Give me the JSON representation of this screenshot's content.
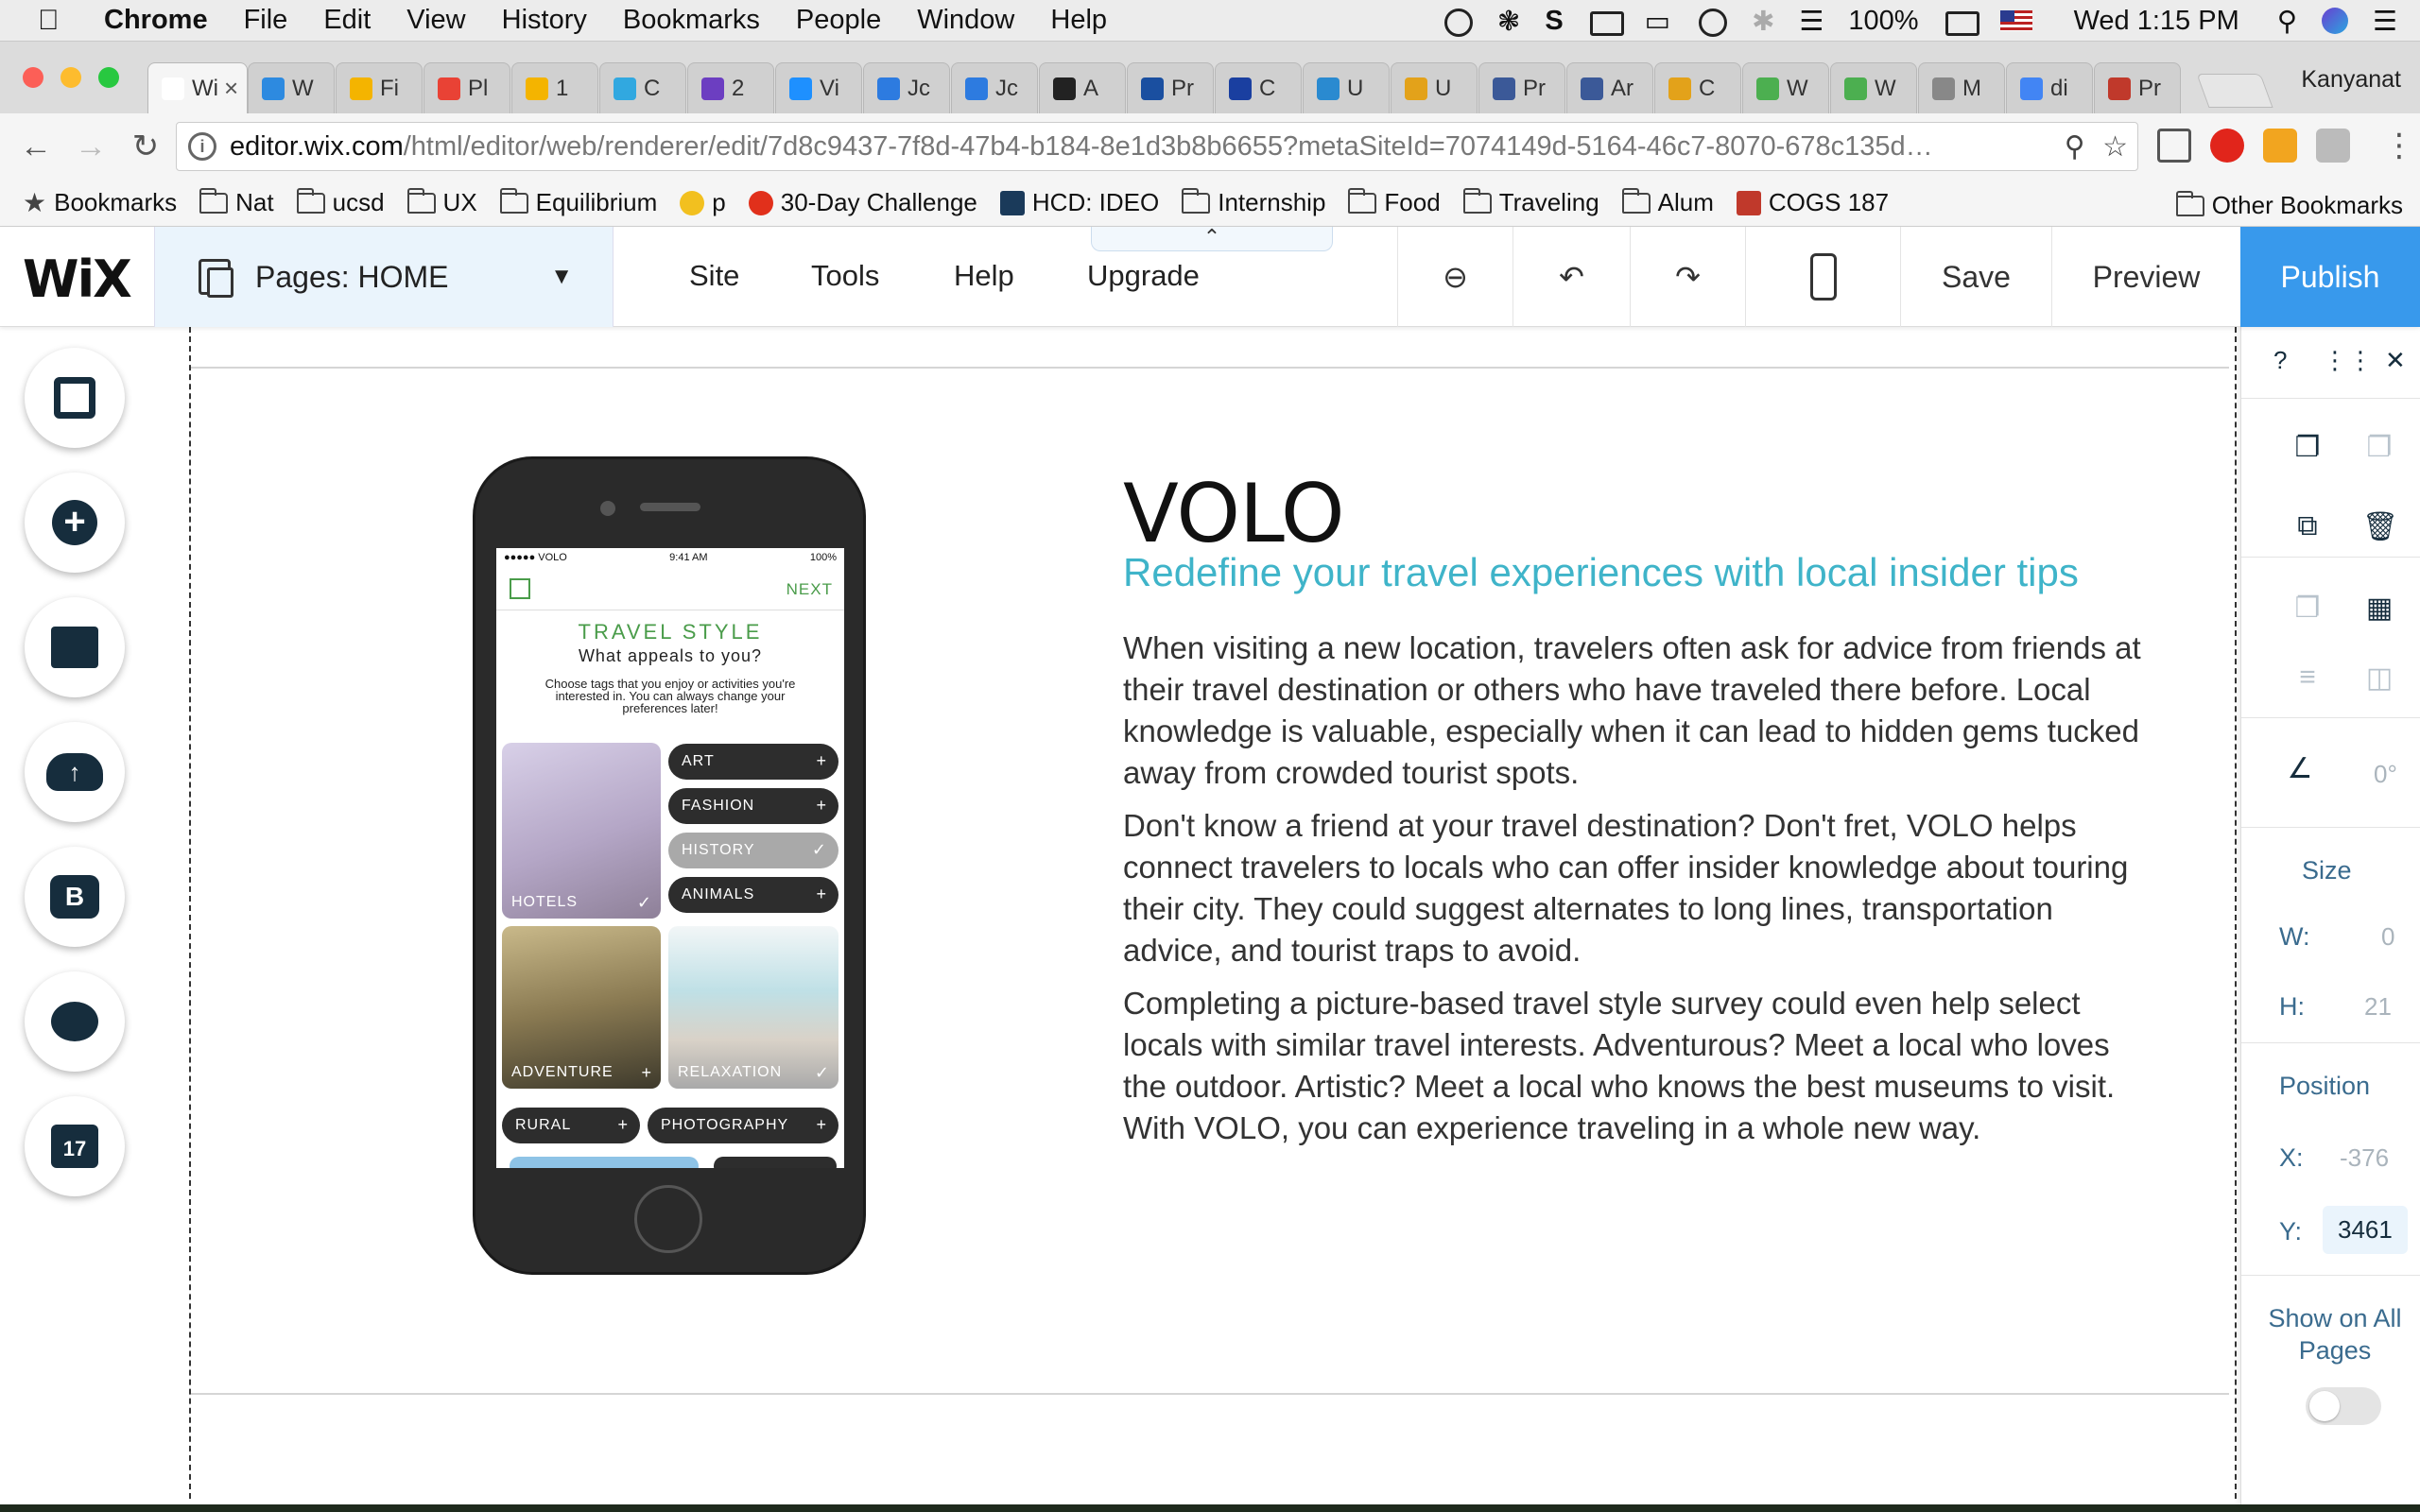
{
  "os_menu": {
    "app": "Chrome",
    "items": [
      "File",
      "Edit",
      "View",
      "History",
      "Bookmarks",
      "People",
      "Window",
      "Help"
    ],
    "battery": "100%",
    "clock": "Wed 1:15 PM"
  },
  "browser": {
    "tabs": [
      {
        "label": "Wi",
        "icon": "wix",
        "color": "#ffffff"
      },
      {
        "label": "W",
        "icon": "star",
        "color": "#2d8ae0"
      },
      {
        "label": "Fi",
        "icon": "slides",
        "color": "#f4b400"
      },
      {
        "label": "Pl",
        "icon": "pinwheel",
        "color": "#e94235"
      },
      {
        "label": "1",
        "icon": "slides",
        "color": "#f4b400"
      },
      {
        "label": "C",
        "icon": "swirl",
        "color": "#31a8e0"
      },
      {
        "label": "2",
        "icon": "diamond",
        "color": "#6c3ec1"
      },
      {
        "label": "Vi",
        "icon": "m",
        "color": "#1e90ff"
      },
      {
        "label": "Jc",
        "icon": "bulb",
        "color": "#2d7be0"
      },
      {
        "label": "Jc",
        "icon": "bulb",
        "color": "#2d7be0"
      },
      {
        "label": "A",
        "icon": "amazon",
        "color": "#222222"
      },
      {
        "label": "Pr",
        "icon": "globe",
        "color": "#1a4fa0"
      },
      {
        "label": "C",
        "icon": "v",
        "color": "#1a3fa0"
      },
      {
        "label": "U",
        "icon": "ps",
        "color": "#2a8ad0"
      },
      {
        "label": "U",
        "icon": "w",
        "color": "#e3a21a"
      },
      {
        "label": "Pr",
        "icon": "fb",
        "color": "#3b5998"
      },
      {
        "label": "Ar",
        "icon": "fb",
        "color": "#3b5998"
      },
      {
        "label": "C",
        "icon": "w",
        "color": "#e3a21a"
      },
      {
        "label": "W",
        "icon": "d",
        "color": "#4caf50"
      },
      {
        "label": "W",
        "icon": "d",
        "color": "#4caf50"
      },
      {
        "label": "M",
        "icon": "doc",
        "color": "#888888"
      },
      {
        "label": "di",
        "icon": "g",
        "color": "#4285f4"
      },
      {
        "label": "Pr",
        "icon": "gem",
        "color": "#c0392b"
      }
    ],
    "profile": "Kanyanat",
    "url_host": "editor.wix.com",
    "url_path": "/html/editor/web/renderer/edit/7d8c9437-7f8d-47b4-b184-8e1d3b8b6655?metaSiteId=7074149d-5164-46c7-8070-678c135d…",
    "bookmarks": [
      {
        "label": "Bookmarks",
        "icon": "star"
      },
      {
        "label": "Nat",
        "icon": "folder"
      },
      {
        "label": "ucsd",
        "icon": "folder"
      },
      {
        "label": "UX",
        "icon": "folder"
      },
      {
        "label": "Equilibrium",
        "icon": "folder"
      },
      {
        "label": "p",
        "icon": "emoji"
      },
      {
        "label": "30-Day Challenge",
        "icon": "red-circle"
      },
      {
        "label": "HCD: IDEO",
        "icon": "ideo"
      },
      {
        "label": "Internship",
        "icon": "folder"
      },
      {
        "label": "Food",
        "icon": "folder"
      },
      {
        "label": "Traveling",
        "icon": "folder"
      },
      {
        "label": "Alum",
        "icon": "folder"
      },
      {
        "label": "COGS 187",
        "icon": "book"
      }
    ],
    "other_bookmarks": "Other Bookmarks"
  },
  "editor": {
    "pages_label": "Pages: HOME",
    "nav": [
      "Site",
      "Tools",
      "Help",
      "Upgrade"
    ],
    "save": "Save",
    "preview": "Preview",
    "publish": "Publish",
    "accent": "#3899ec"
  },
  "phone_app": {
    "status_left": "●●●●● VOLO",
    "status_time": "9:41 AM",
    "status_battery": "100%",
    "next": "NEXT",
    "title": "TRAVEL STYLE",
    "subtitle": "What appeals to you?",
    "description": "Choose tags that you enjoy or activities you're interested in. You can always change your preferences later!",
    "tiles": [
      {
        "label": "HOTELS",
        "mark": "✓"
      },
      {
        "label": "ADVENTURE",
        "mark": "+"
      },
      {
        "label": "RELAXATION",
        "mark": "✓"
      }
    ],
    "pills": [
      {
        "label": "ART",
        "mark": "+"
      },
      {
        "label": "FASHION",
        "mark": "+"
      },
      {
        "label": "HISTORY",
        "mark": "✓"
      },
      {
        "label": "ANIMALS",
        "mark": "+"
      },
      {
        "label": "RURAL",
        "mark": "+"
      },
      {
        "label": "PHOTOGRAPHY",
        "mark": "+"
      }
    ]
  },
  "content": {
    "title": "VOLO",
    "tagline": "Redefine your travel experiences with local insider tips",
    "paragraphs": [
      "When visiting a new location, travelers often ask for advice from friends at their travel destination or others who have traveled there before. Local knowledge is valuable, especially when it can lead to hidden gems tucked away from crowded tourist spots.",
      "Don't know a friend at your travel destination? Don't fret, VOLO helps connect travelers to locals who can offer insider knowledge about touring their city. They could suggest alternates to long lines, transportation advice, and tourist traps to avoid.",
      "Completing a picture-based travel style survey could even help select locals with similar travel interests. Adventurous? Meet a local who loves the outdoor. Artistic? Meet a local who knows the best museums to visit. With VOLO, you can experience traveling in a whole new way."
    ],
    "tagline_color": "#3fb4c9"
  },
  "inspector": {
    "help": "?",
    "rotation": "0°",
    "size_label": "Size",
    "w_label": "W:",
    "w_value": "0",
    "h_label": "H:",
    "h_value": "21",
    "position_label": "Position",
    "x_label": "X:",
    "x_value": "-376",
    "y_label": "Y:",
    "y_value": "3461",
    "show_all": "Show on All Pages"
  }
}
